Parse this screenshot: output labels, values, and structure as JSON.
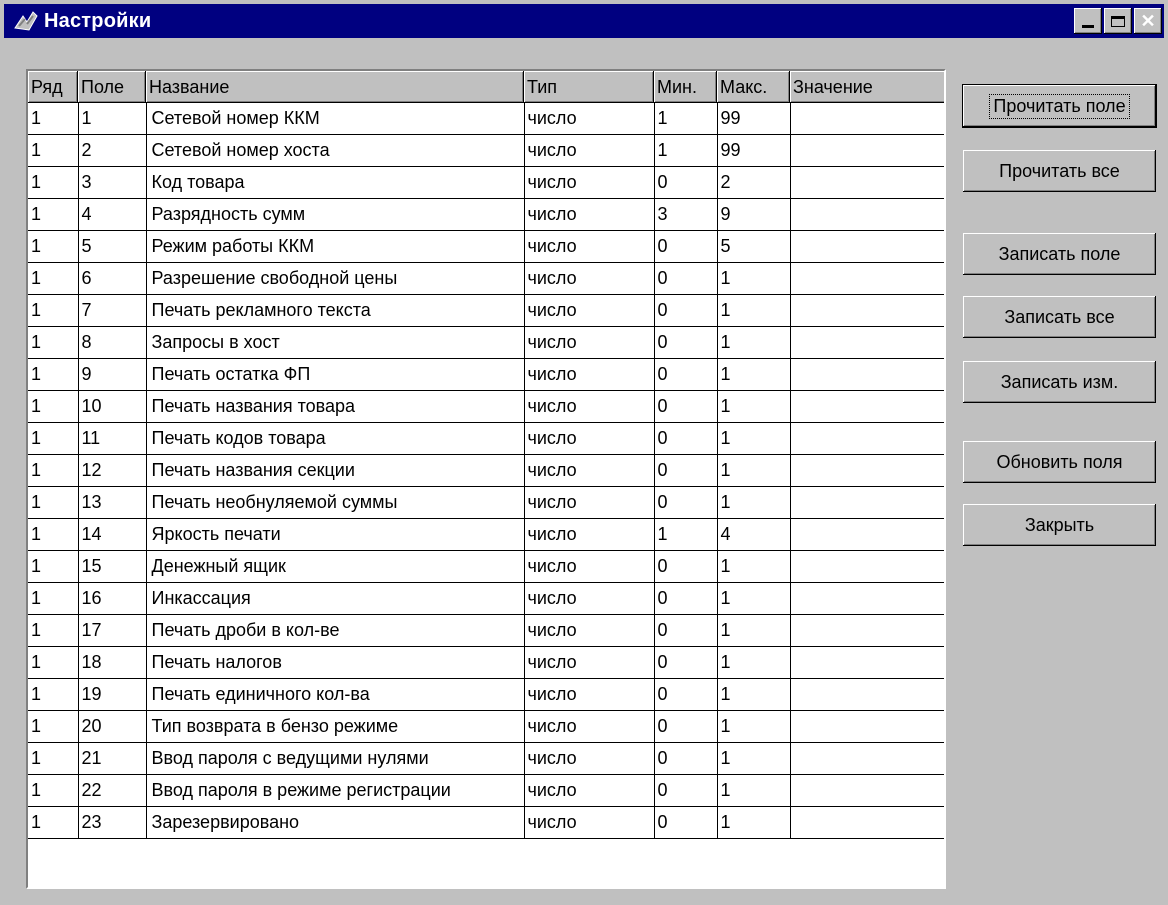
{
  "window": {
    "title": "Настройки"
  },
  "columns": [
    "Ряд",
    "Поле",
    "Название",
    "Тип",
    "Мин.",
    "Макс.",
    "Значение"
  ],
  "rows": [
    [
      "1",
      "1",
      "Сетевой номер ККМ",
      "число",
      "1",
      "99",
      ""
    ],
    [
      "1",
      "2",
      "Сетевой номер хоста",
      "число",
      "1",
      "99",
      ""
    ],
    [
      "1",
      "3",
      "Код товара",
      "число",
      "0",
      "2",
      ""
    ],
    [
      "1",
      "4",
      "Разрядность сумм",
      "число",
      "3",
      "9",
      ""
    ],
    [
      "1",
      "5",
      "Режим работы ККМ",
      "число",
      "0",
      "5",
      ""
    ],
    [
      "1",
      "6",
      "Разрешение свободной цены",
      "число",
      "0",
      "1",
      ""
    ],
    [
      "1",
      "7",
      "Печать рекламного текста",
      "число",
      "0",
      "1",
      ""
    ],
    [
      "1",
      "8",
      "Запросы в хост",
      "число",
      "0",
      "1",
      ""
    ],
    [
      "1",
      "9",
      "Печать остатка ФП",
      "число",
      "0",
      "1",
      ""
    ],
    [
      "1",
      "10",
      "Печать названия товара",
      "число",
      "0",
      "1",
      ""
    ],
    [
      "1",
      "11",
      "Печать кодов товара",
      "число",
      "0",
      "1",
      ""
    ],
    [
      "1",
      "12",
      "Печать названия секции",
      "число",
      "0",
      "1",
      ""
    ],
    [
      "1",
      "13",
      "Печать необнуляемой суммы",
      "число",
      "0",
      "1",
      ""
    ],
    [
      "1",
      "14",
      "Яркость печати",
      "число",
      "1",
      "4",
      ""
    ],
    [
      "1",
      "15",
      "Денежный ящик",
      "число",
      "0",
      "1",
      ""
    ],
    [
      "1",
      "16",
      "Инкассация",
      "число",
      "0",
      "1",
      ""
    ],
    [
      "1",
      "17",
      "Печать дроби в кол-ве",
      "число",
      "0",
      "1",
      ""
    ],
    [
      "1",
      "18",
      "Печать налогов",
      "число",
      "0",
      "1",
      ""
    ],
    [
      "1",
      "19",
      "Печать единичного кол-ва",
      "число",
      "0",
      "1",
      ""
    ],
    [
      "1",
      "20",
      "Тип возврата в бензо режиме",
      "число",
      "0",
      "1",
      ""
    ],
    [
      "1",
      "21",
      "Ввод пароля с ведущими нулями",
      "число",
      "0",
      "1",
      ""
    ],
    [
      "1",
      "22",
      "Ввод пароля в режиме регистрации",
      "число",
      "0",
      "1",
      ""
    ],
    [
      "1",
      "23",
      "Зарезервировано",
      "число",
      "0",
      "1",
      ""
    ]
  ],
  "buttons": {
    "read_field": "Прочитать поле",
    "read_all": "Прочитать все",
    "write_field": "Записать поле",
    "write_all": "Записать все",
    "write_changed": "Записать изм.",
    "refresh_fields": "Обновить поля",
    "close": "Закрыть"
  },
  "icons": {
    "app": "app-icon",
    "minimize": "minimize-icon",
    "maximize": "maximize-icon",
    "close": "close-icon"
  },
  "colors": {
    "titlebar": "#000080",
    "face": "#c0c0c0",
    "grid_bg": "#ffffff"
  }
}
